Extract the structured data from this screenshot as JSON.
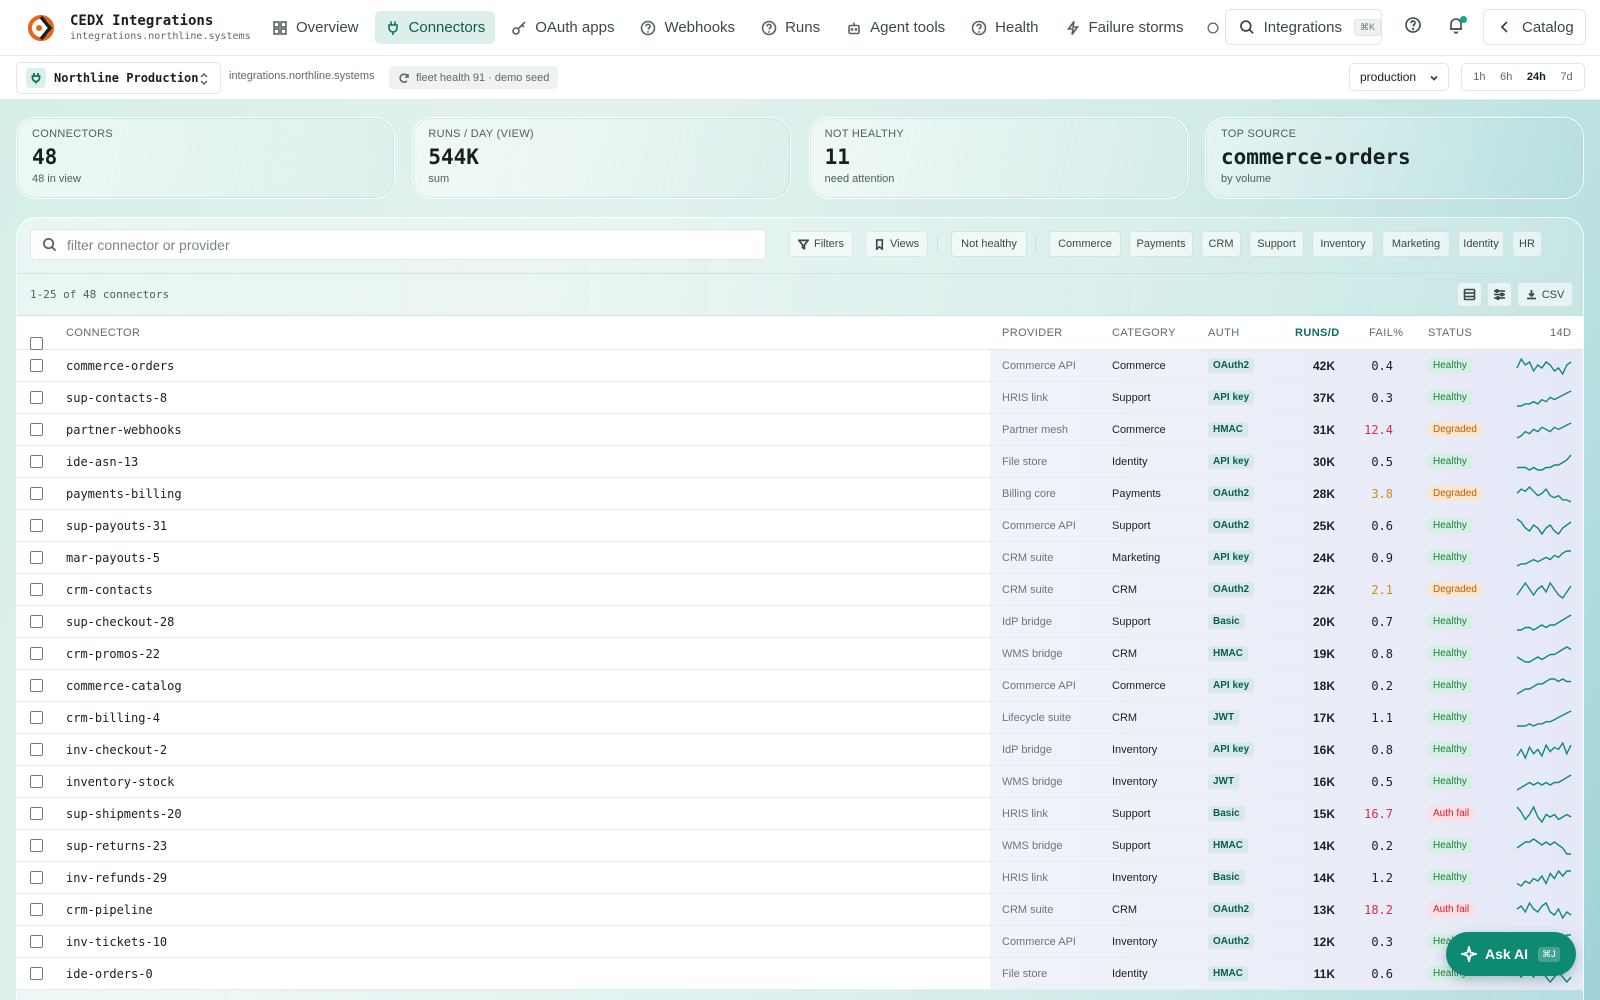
{
  "brand": {
    "title": "CEDX Integrations",
    "host": "integrations.northline.systems"
  },
  "nav": [
    {
      "label": "Overview",
      "icon": "grid-icon",
      "active": false
    },
    {
      "label": "Connectors",
      "icon": "plug-icon",
      "active": true
    },
    {
      "label": "OAuth apps",
      "icon": "key-icon",
      "active": false
    },
    {
      "label": "Webhooks",
      "icon": "help-circle-icon",
      "active": false
    },
    {
      "label": "Runs",
      "icon": "help-circle-icon",
      "active": false
    },
    {
      "label": "Agent tools",
      "icon": "robot-icon",
      "active": false
    },
    {
      "label": "Health",
      "icon": "help-circle-icon",
      "active": false
    },
    {
      "label": "Failure storms",
      "icon": "bolt-icon",
      "active": false
    }
  ],
  "search": {
    "label": "Integrations",
    "shortcut": "⌘K"
  },
  "catalog_label": "Catalog",
  "org": {
    "name": "Northline Production",
    "host": "integrations.northline.systems",
    "health": "fleet health 91 · demo seed"
  },
  "env": {
    "selected": "production"
  },
  "ranges": [
    {
      "label": "1h",
      "on": false
    },
    {
      "label": "6h",
      "on": false
    },
    {
      "label": "24h",
      "on": true
    },
    {
      "label": "7d",
      "on": false
    }
  ],
  "kpis": [
    {
      "label": "CONNECTORS",
      "value": "48",
      "sub": "48 in view"
    },
    {
      "label": "RUNS / DAY (VIEW)",
      "value": "544K",
      "sub": "sum"
    },
    {
      "label": "NOT HEALTHY",
      "value": "11",
      "sub": "need attention"
    },
    {
      "label": "TOP SOURCE",
      "value": "commerce-orders",
      "sub": "by volume"
    }
  ],
  "filter": {
    "placeholder": "filter connector or provider",
    "filters_label": "Filters",
    "views_label": "Views",
    "not_healthy_label": "Not healthy",
    "categories": [
      "Commerce",
      "Payments",
      "CRM",
      "Support",
      "Inventory",
      "Marketing",
      "Identity",
      "HR"
    ]
  },
  "count_text": "1-25 of 48 connectors",
  "csv_label": "CSV",
  "columns": {
    "connector": "CONNECTOR",
    "provider": "PROVIDER",
    "category": "CATEGORY",
    "auth": "AUTH",
    "runs": "RUNS/D",
    "fail": "FAIL%",
    "status": "STATUS",
    "trend": "14D"
  },
  "status_colors": {
    "Healthy": {
      "bg": "#d7efe2",
      "fg": "#1f7a45"
    },
    "Degraded": {
      "bg": "#fbe6cf",
      "fg": "#b4610b"
    },
    "Auth fail": {
      "bg": "#fbe0e3",
      "fg": "#c4223c"
    }
  },
  "fail_colors": {
    "normal": "#16211f",
    "warn": "#d08a10",
    "bad": "#d32f4a"
  },
  "rows": [
    {
      "name": "commerce-orders",
      "provider": "Commerce API",
      "category": "Commerce",
      "auth": "OAuth2",
      "runs": "42K",
      "fail": "0.4",
      "fail_level": "normal",
      "status": "Healthy",
      "trend": [
        6,
        9,
        7,
        8,
        5,
        7,
        6,
        8,
        7,
        5,
        6,
        4,
        7,
        8
      ]
    },
    {
      "name": "sup-contacts-8",
      "provider": "HRIS link",
      "category": "Support",
      "auth": "API key",
      "runs": "37K",
      "fail": "0.3",
      "fail_level": "normal",
      "status": "Healthy",
      "trend": [
        2,
        2,
        3,
        3,
        4,
        3,
        5,
        4,
        6,
        5,
        6,
        7,
        8,
        9
      ]
    },
    {
      "name": "partner-webhooks",
      "provider": "Partner mesh",
      "category": "Commerce",
      "auth": "HMAC",
      "runs": "31K",
      "fail": "12.4",
      "fail_level": "bad",
      "status": "Degraded",
      "trend": [
        2,
        3,
        5,
        4,
        6,
        5,
        7,
        6,
        5,
        7,
        6,
        7,
        8,
        9
      ]
    },
    {
      "name": "ide-asn-13",
      "provider": "File store",
      "category": "Identity",
      "auth": "API key",
      "runs": "30K",
      "fail": "0.5",
      "fail_level": "normal",
      "status": "Healthy",
      "trend": [
        3,
        3,
        3,
        2,
        3,
        2,
        2,
        3,
        3,
        4,
        4,
        5,
        6,
        8
      ]
    },
    {
      "name": "payments-billing",
      "provider": "Billing core",
      "category": "Payments",
      "auth": "OAuth2",
      "runs": "28K",
      "fail": "3.8",
      "fail_level": "warn",
      "status": "Degraded",
      "trend": [
        6,
        8,
        7,
        9,
        7,
        5,
        6,
        8,
        5,
        4,
        5,
        3,
        3,
        2
      ]
    },
    {
      "name": "sup-payouts-31",
      "provider": "Commerce API",
      "category": "Support",
      "auth": "OAuth2",
      "runs": "25K",
      "fail": "0.6",
      "fail_level": "normal",
      "status": "Healthy",
      "trend": [
        8,
        7,
        5,
        4,
        6,
        5,
        3,
        5,
        6,
        4,
        3,
        5,
        6,
        7
      ]
    },
    {
      "name": "mar-payouts-5",
      "provider": "CRM suite",
      "category": "Marketing",
      "auth": "API key",
      "runs": "24K",
      "fail": "0.9",
      "fail_level": "normal",
      "status": "Healthy",
      "trend": [
        2,
        3,
        3,
        4,
        5,
        4,
        5,
        6,
        5,
        7,
        6,
        8,
        9,
        9
      ]
    },
    {
      "name": "crm-contacts",
      "provider": "CRM suite",
      "category": "CRM",
      "auth": "OAuth2",
      "runs": "22K",
      "fail": "2.1",
      "fail_level": "warn",
      "status": "Degraded",
      "trend": [
        4,
        6,
        8,
        6,
        4,
        6,
        7,
        5,
        8,
        6,
        4,
        3,
        5,
        7
      ]
    },
    {
      "name": "sup-checkout-28",
      "provider": "IdP bridge",
      "category": "Support",
      "auth": "Basic",
      "runs": "20K",
      "fail": "0.7",
      "fail_level": "normal",
      "status": "Healthy",
      "trend": [
        3,
        3,
        4,
        4,
        3,
        4,
        5,
        4,
        5,
        5,
        6,
        7,
        8,
        9
      ]
    },
    {
      "name": "crm-promos-22",
      "provider": "WMS bridge",
      "category": "CRM",
      "auth": "HMAC",
      "runs": "19K",
      "fail": "0.8",
      "fail_level": "normal",
      "status": "Healthy",
      "trend": [
        5,
        4,
        3,
        3,
        4,
        5,
        4,
        5,
        6,
        6,
        7,
        8,
        9,
        8
      ]
    },
    {
      "name": "commerce-catalog",
      "provider": "Commerce API",
      "category": "Commerce",
      "auth": "API key",
      "runs": "18K",
      "fail": "0.2",
      "fail_level": "normal",
      "status": "Healthy",
      "trend": [
        2,
        3,
        4,
        4,
        5,
        6,
        6,
        7,
        8,
        8,
        7,
        8,
        7,
        7
      ]
    },
    {
      "name": "crm-billing-4",
      "provider": "Lifecycle suite",
      "category": "CRM",
      "auth": "JWT",
      "runs": "17K",
      "fail": "1.1",
      "fail_level": "normal",
      "status": "Healthy",
      "trend": [
        2,
        2,
        2,
        3,
        2,
        3,
        3,
        4,
        4,
        5,
        6,
        7,
        8,
        9
      ]
    },
    {
      "name": "inv-checkout-2",
      "provider": "IdP bridge",
      "category": "Inventory",
      "auth": "API key",
      "runs": "16K",
      "fail": "0.8",
      "fail_level": "normal",
      "status": "Healthy",
      "trend": [
        3,
        6,
        2,
        7,
        4,
        6,
        3,
        8,
        5,
        7,
        6,
        9,
        4,
        8
      ]
    },
    {
      "name": "inventory-stock",
      "provider": "WMS bridge",
      "category": "Inventory",
      "auth": "JWT",
      "runs": "16K",
      "fail": "0.5",
      "fail_level": "normal",
      "status": "Healthy",
      "trend": [
        3,
        4,
        5,
        6,
        5,
        6,
        5,
        6,
        5,
        6,
        6,
        7,
        8,
        9
      ]
    },
    {
      "name": "sup-shipments-20",
      "provider": "HRIS link",
      "category": "Support",
      "auth": "Basic",
      "runs": "15K",
      "fail": "16.7",
      "fail_level": "bad",
      "status": "Auth fail",
      "trend": [
        8,
        6,
        3,
        5,
        8,
        4,
        2,
        5,
        4,
        5,
        3,
        4,
        5,
        4
      ]
    },
    {
      "name": "sup-returns-23",
      "provider": "WMS bridge",
      "category": "Support",
      "auth": "HMAC",
      "runs": "14K",
      "fail": "0.2",
      "fail_level": "normal",
      "status": "Healthy",
      "trend": [
        5,
        6,
        7,
        7,
        8,
        7,
        6,
        7,
        6,
        7,
        6,
        5,
        3,
        3
      ]
    },
    {
      "name": "inv-refunds-29",
      "provider": "HRIS link",
      "category": "Inventory",
      "auth": "Basic",
      "runs": "14K",
      "fail": "1.2",
      "fail_level": "normal",
      "status": "Healthy",
      "trend": [
        4,
        3,
        5,
        4,
        6,
        5,
        7,
        4,
        8,
        6,
        9,
        7,
        9,
        9
      ]
    },
    {
      "name": "crm-pipeline",
      "provider": "CRM suite",
      "category": "CRM",
      "auth": "OAuth2",
      "runs": "13K",
      "fail": "18.2",
      "fail_level": "bad",
      "status": "Auth fail",
      "trend": [
        6,
        7,
        5,
        8,
        6,
        5,
        7,
        8,
        5,
        4,
        6,
        3,
        5,
        4
      ]
    },
    {
      "name": "inv-tickets-10",
      "provider": "Commerce API",
      "category": "Inventory",
      "auth": "OAuth2",
      "runs": "12K",
      "fail": "0.3",
      "fail_level": "normal",
      "status": "Healthy",
      "trend": [
        5,
        5,
        6,
        5,
        6,
        6,
        7,
        6,
        7,
        7,
        8,
        7,
        8,
        8
      ]
    },
    {
      "name": "ide-orders-0",
      "provider": "File store",
      "category": "Identity",
      "auth": "HMAC",
      "runs": "11K",
      "fail": "0.6",
      "fail_level": "normal",
      "status": "Healthy",
      "trend": [
        5,
        4,
        6,
        5,
        4,
        6,
        5,
        4,
        3,
        4,
        5,
        4,
        3,
        4
      ]
    }
  ],
  "ask_ai": {
    "label": "Ask AI",
    "shortcut": "⌘J"
  }
}
